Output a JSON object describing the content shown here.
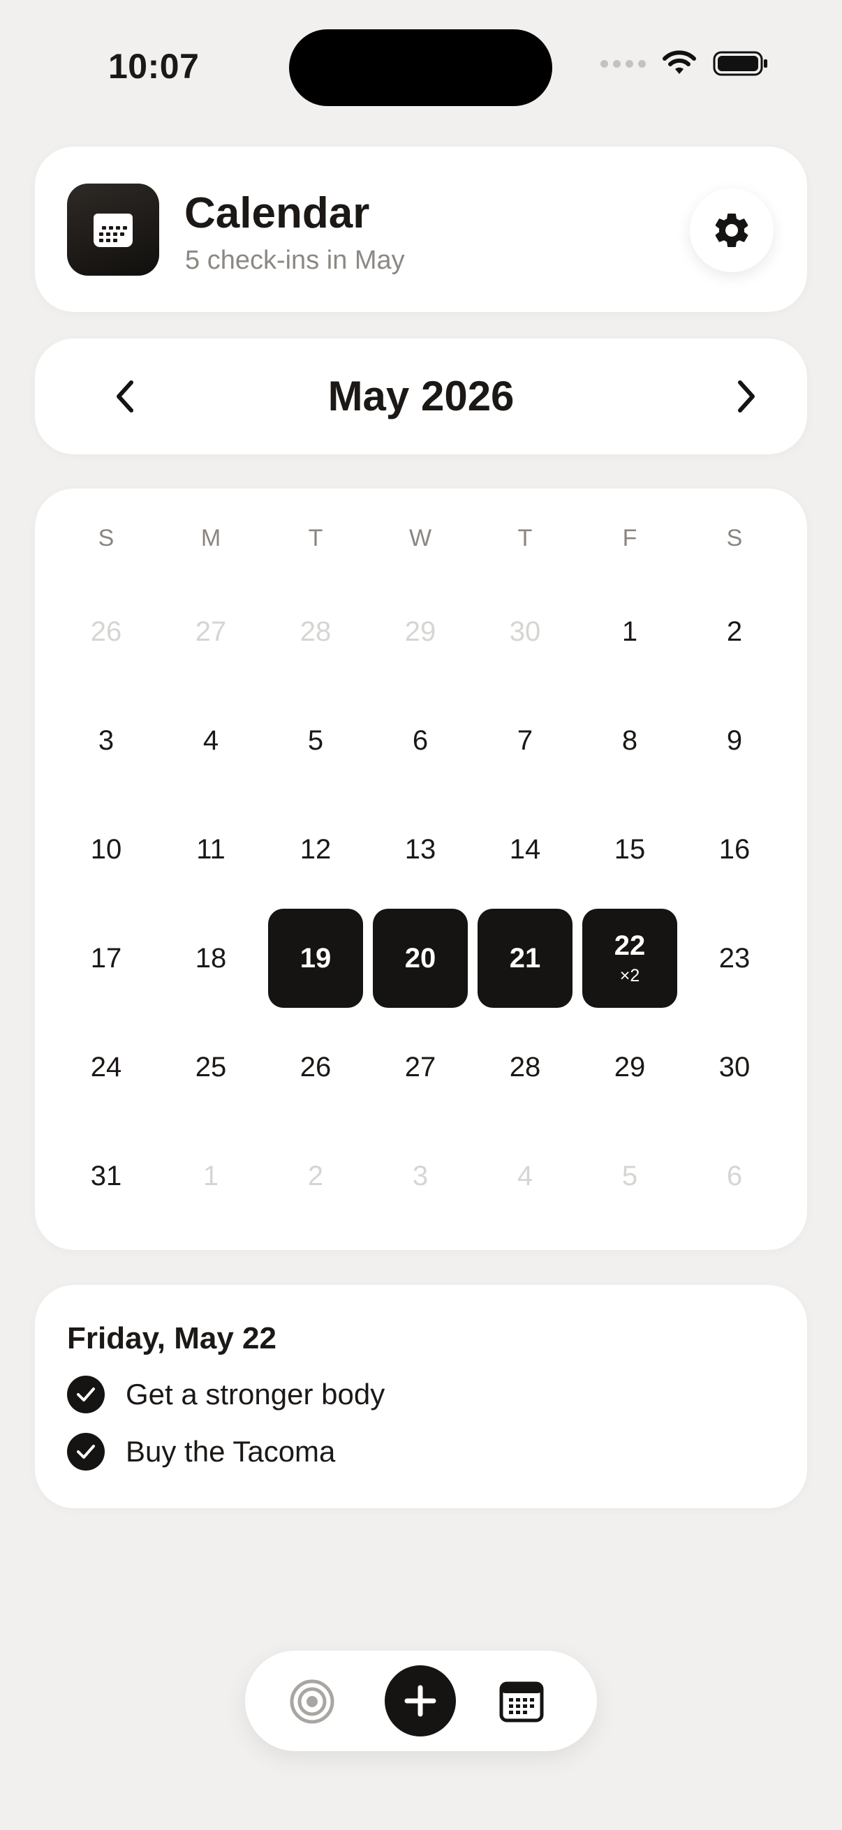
{
  "status_bar": {
    "time": "10:07"
  },
  "header": {
    "title": "Calendar",
    "subtitle": "5 check-ins in May"
  },
  "month_nav": {
    "title": "May 2026"
  },
  "weekdays": [
    "S",
    "M",
    "T",
    "W",
    "T",
    "F",
    "S"
  ],
  "weeks": [
    [
      {
        "d": "26",
        "muted": true
      },
      {
        "d": "27",
        "muted": true
      },
      {
        "d": "28",
        "muted": true
      },
      {
        "d": "29",
        "muted": true
      },
      {
        "d": "30",
        "muted": true
      },
      {
        "d": "1"
      },
      {
        "d": "2"
      }
    ],
    [
      {
        "d": "3"
      },
      {
        "d": "4"
      },
      {
        "d": "5"
      },
      {
        "d": "6"
      },
      {
        "d": "7"
      },
      {
        "d": "8"
      },
      {
        "d": "9"
      }
    ],
    [
      {
        "d": "10"
      },
      {
        "d": "11"
      },
      {
        "d": "12"
      },
      {
        "d": "13"
      },
      {
        "d": "14"
      },
      {
        "d": "15"
      },
      {
        "d": "16"
      }
    ],
    [
      {
        "d": "17"
      },
      {
        "d": "18"
      },
      {
        "d": "19",
        "active": true
      },
      {
        "d": "20",
        "active": true
      },
      {
        "d": "21",
        "active": true
      },
      {
        "d": "22",
        "active": true,
        "count": "×2"
      },
      {
        "d": "23"
      }
    ],
    [
      {
        "d": "24"
      },
      {
        "d": "25"
      },
      {
        "d": "26"
      },
      {
        "d": "27"
      },
      {
        "d": "28"
      },
      {
        "d": "29"
      },
      {
        "d": "30"
      }
    ],
    [
      {
        "d": "31"
      },
      {
        "d": "1",
        "muted": true
      },
      {
        "d": "2",
        "muted": true
      },
      {
        "d": "3",
        "muted": true
      },
      {
        "d": "4",
        "muted": true
      },
      {
        "d": "5",
        "muted": true
      },
      {
        "d": "6",
        "muted": true
      }
    ]
  ],
  "detail": {
    "date": "Friday, May 22",
    "items": [
      "Get a stronger body",
      "Buy the Tacoma"
    ]
  },
  "icons": {
    "app": "calendar-icon",
    "settings": "gear-icon",
    "prev": "chevron-left-icon",
    "next": "chevron-right-icon",
    "check": "checkmark-icon",
    "tab_goals": "target-icon",
    "tab_add": "plus-icon",
    "tab_calendar": "calendar-icon"
  },
  "colors": {
    "background": "#f1f0ee",
    "active_day": "#161412",
    "muted_text": "#d7d5d2",
    "secondary_text": "#8d8883"
  }
}
